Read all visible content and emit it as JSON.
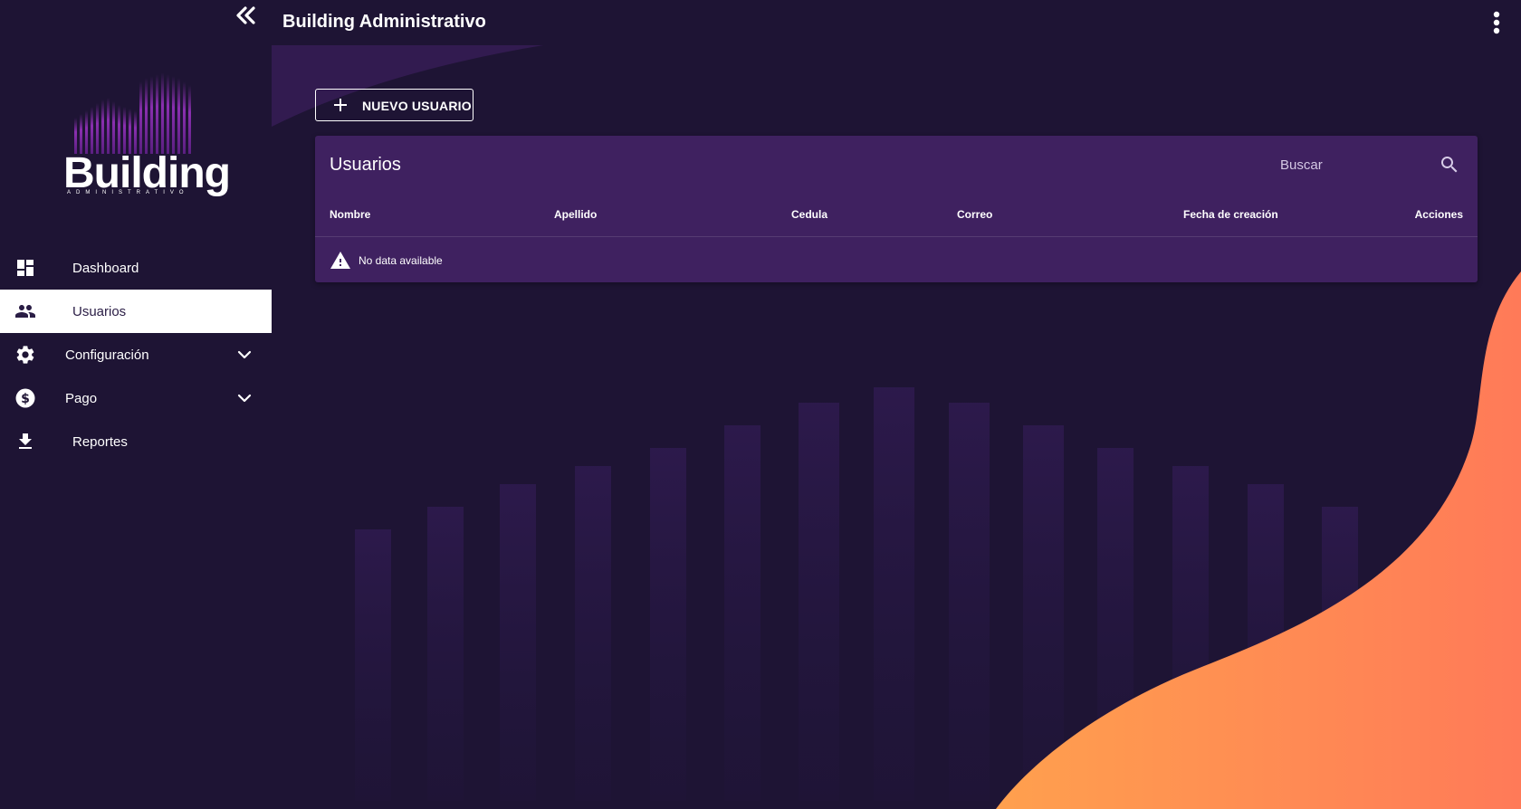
{
  "app": {
    "title": "Building Administrativo",
    "logo_word": "Building",
    "logo_sub": "ADMINISTRATIVO"
  },
  "sidebar": {
    "items": [
      {
        "label": "Dashboard",
        "icon": "dashboard-icon"
      },
      {
        "label": "Usuarios",
        "icon": "people-icon",
        "active": true
      },
      {
        "label": "Configuración",
        "icon": "gear-icon",
        "expandable": true
      },
      {
        "label": "Pago",
        "icon": "dollar-circle-icon",
        "expandable": true
      },
      {
        "label": "Reportes",
        "icon": "download-icon"
      }
    ]
  },
  "toolbar": {
    "new_user_label": "NUEVO USUARIO"
  },
  "table": {
    "title": "Usuarios",
    "search_placeholder": "Buscar",
    "columns": [
      "Nombre",
      "Apellido",
      "Cedula",
      "Correo",
      "Fecha de creación",
      "Acciones"
    ],
    "rows": [],
    "empty_text": "No data available"
  },
  "colors": {
    "background": "#1e1434",
    "card": "#3f2160",
    "accent_orange": "#ff8c50"
  }
}
